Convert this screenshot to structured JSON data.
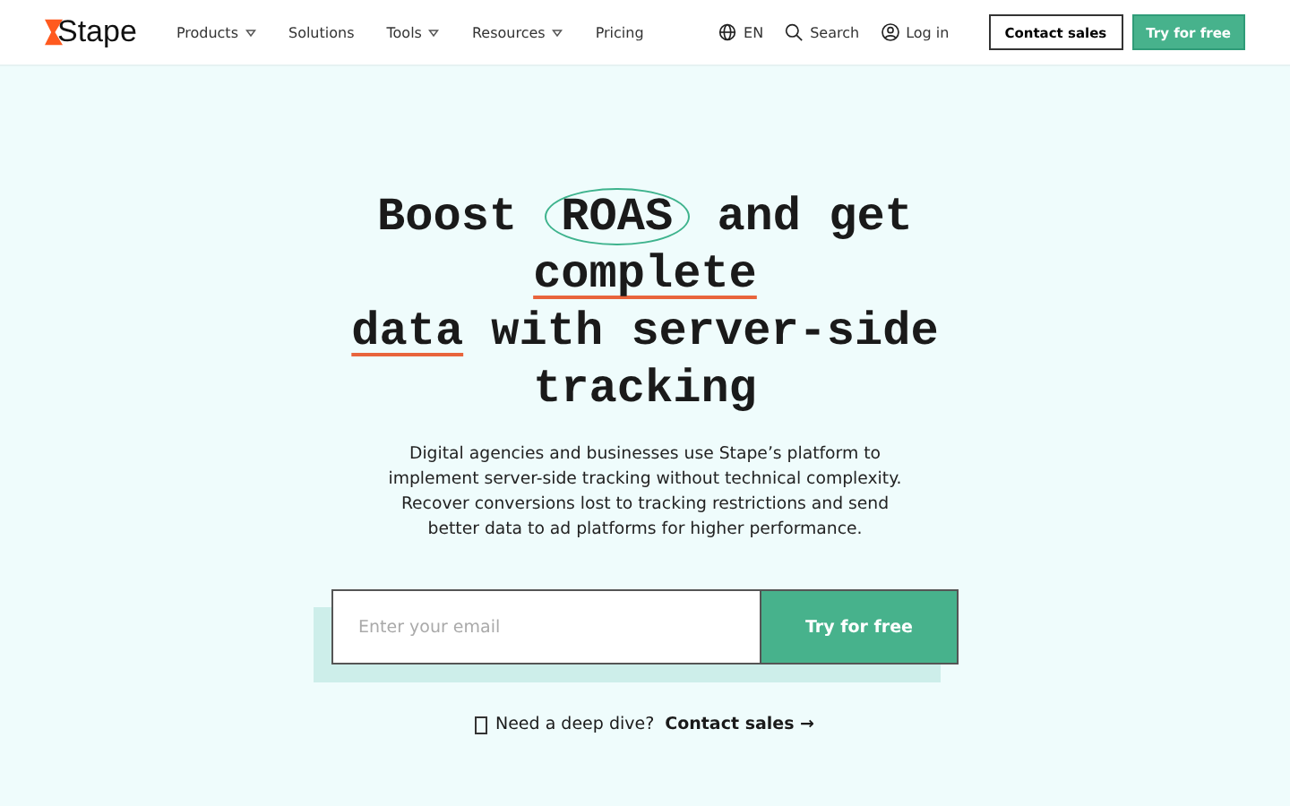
{
  "nav": {
    "logo": "Stape",
    "items": [
      {
        "label": "Products",
        "dropdown": true
      },
      {
        "label": "Solutions",
        "dropdown": false
      },
      {
        "label": "Tools",
        "dropdown": true
      },
      {
        "label": "Resources",
        "dropdown": true
      },
      {
        "label": "Pricing",
        "dropdown": false
      }
    ],
    "language": "EN",
    "search": "Search",
    "login": "Log in",
    "contact": "Contact sales",
    "try": "Try for free"
  },
  "hero": {
    "heading": [
      [
        {
          "text": "Boost ",
          "kind": "plain"
        },
        {
          "text": "ROAS",
          "kind": "circled"
        },
        {
          "text": " and get",
          "kind": "plain"
        }
      ],
      [
        {
          "text": "complete",
          "kind": "underlined"
        }
      ],
      [
        {
          "text": "data",
          "kind": "underlined"
        },
        {
          "text": " with server-side",
          "kind": "plain"
        }
      ],
      [
        {
          "text": "tracking",
          "kind": "plain"
        }
      ]
    ],
    "description": "Digital agencies and businesses use Stape’s platform to implement server-side tracking without technical complexity. Recover conversions lost to tracking restrictions and send better data to ad platforms for higher performance.",
    "email": {
      "placeholder": "Enter your email"
    },
    "submit": "Try for free",
    "prompt": "Need a deep dive?",
    "link": "Contact sales →"
  }
}
